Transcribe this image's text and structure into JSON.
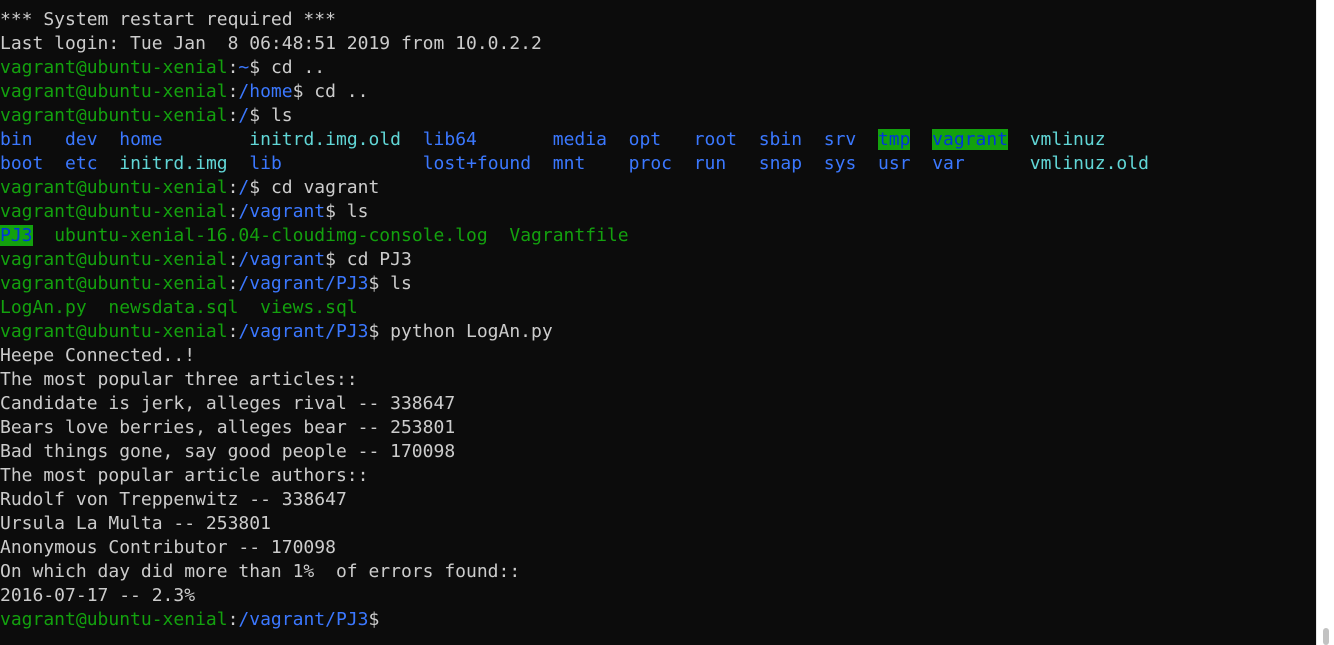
{
  "window": {
    "title": "vagrant@ubuntu-xenial: /vagrant/PJ3"
  },
  "colors": {
    "background": "#0c0c0c",
    "text": "#cccccc",
    "prompt_green": "#13a10e",
    "path_blue": "#3b78ff",
    "file_cyan": "#61d6d6",
    "highlight_bg": "#13a10e"
  },
  "terminal": {
    "lines": [
      {
        "segments": [
          {
            "text": "*** System restart required ***",
            "style": "white"
          }
        ]
      },
      {
        "segments": [
          {
            "text": "Last login: Tue Jan  8 06:48:51 2019 from 10.0.2.2",
            "style": "white"
          }
        ]
      },
      {
        "segments": [
          {
            "text": "vagrant@ubuntu-xenial",
            "style": "green"
          },
          {
            "text": ":",
            "style": "white"
          },
          {
            "text": "~",
            "style": "blue"
          },
          {
            "text": "$ cd ..",
            "style": "white"
          }
        ]
      },
      {
        "segments": [
          {
            "text": "vagrant@ubuntu-xenial",
            "style": "green"
          },
          {
            "text": ":",
            "style": "white"
          },
          {
            "text": "/home",
            "style": "blue"
          },
          {
            "text": "$ cd ..",
            "style": "white"
          }
        ]
      },
      {
        "segments": [
          {
            "text": "vagrant@ubuntu-xenial",
            "style": "green"
          },
          {
            "text": ":",
            "style": "white"
          },
          {
            "text": "/",
            "style": "blue"
          },
          {
            "text": "$ ls",
            "style": "white"
          }
        ]
      },
      {
        "segments": [
          {
            "text": "bin",
            "style": "blue"
          },
          {
            "text": "   ",
            "style": "white"
          },
          {
            "text": "dev",
            "style": "blue"
          },
          {
            "text": "  ",
            "style": "white"
          },
          {
            "text": "home",
            "style": "blue"
          },
          {
            "text": "        ",
            "style": "white"
          },
          {
            "text": "initrd.img.old",
            "style": "cyan"
          },
          {
            "text": "  ",
            "style": "white"
          },
          {
            "text": "lib64",
            "style": "blue"
          },
          {
            "text": "       ",
            "style": "white"
          },
          {
            "text": "media",
            "style": "blue"
          },
          {
            "text": "  ",
            "style": "white"
          },
          {
            "text": "opt",
            "style": "blue"
          },
          {
            "text": "   ",
            "style": "white"
          },
          {
            "text": "root",
            "style": "blue"
          },
          {
            "text": "  ",
            "style": "white"
          },
          {
            "text": "sbin",
            "style": "blue"
          },
          {
            "text": "  ",
            "style": "white"
          },
          {
            "text": "srv",
            "style": "blue"
          },
          {
            "text": "  ",
            "style": "white"
          },
          {
            "text": "tmp",
            "style": "hl"
          },
          {
            "text": "  ",
            "style": "white"
          },
          {
            "text": "vagrant",
            "style": "hl"
          },
          {
            "text": "  ",
            "style": "white"
          },
          {
            "text": "vmlinuz",
            "style": "cyan"
          }
        ]
      },
      {
        "segments": [
          {
            "text": "boot",
            "style": "blue"
          },
          {
            "text": "  ",
            "style": "white"
          },
          {
            "text": "etc",
            "style": "blue"
          },
          {
            "text": "  ",
            "style": "white"
          },
          {
            "text": "initrd.img",
            "style": "cyan"
          },
          {
            "text": "  ",
            "style": "white"
          },
          {
            "text": "lib",
            "style": "blue"
          },
          {
            "text": "             ",
            "style": "white"
          },
          {
            "text": "lost+found",
            "style": "blue"
          },
          {
            "text": "  ",
            "style": "white"
          },
          {
            "text": "mnt",
            "style": "blue"
          },
          {
            "text": "    ",
            "style": "white"
          },
          {
            "text": "proc",
            "style": "blue"
          },
          {
            "text": "  ",
            "style": "white"
          },
          {
            "text": "run",
            "style": "blue"
          },
          {
            "text": "   ",
            "style": "white"
          },
          {
            "text": "snap",
            "style": "blue"
          },
          {
            "text": "  ",
            "style": "white"
          },
          {
            "text": "sys",
            "style": "blue"
          },
          {
            "text": "  ",
            "style": "white"
          },
          {
            "text": "usr",
            "style": "blue"
          },
          {
            "text": "  ",
            "style": "white"
          },
          {
            "text": "var",
            "style": "blue"
          },
          {
            "text": "      ",
            "style": "white"
          },
          {
            "text": "vmlinuz.old",
            "style": "cyan"
          }
        ]
      },
      {
        "segments": [
          {
            "text": "vagrant@ubuntu-xenial",
            "style": "green"
          },
          {
            "text": ":",
            "style": "white"
          },
          {
            "text": "/",
            "style": "blue"
          },
          {
            "text": "$ cd vagrant",
            "style": "white"
          }
        ]
      },
      {
        "segments": [
          {
            "text": "vagrant@ubuntu-xenial",
            "style": "green"
          },
          {
            "text": ":",
            "style": "white"
          },
          {
            "text": "/vagrant",
            "style": "blue"
          },
          {
            "text": "$ ls",
            "style": "white"
          }
        ]
      },
      {
        "segments": [
          {
            "text": "PJ3",
            "style": "hl"
          },
          {
            "text": "  ",
            "style": "white"
          },
          {
            "text": "ubuntu-xenial-16.04-cloudimg-console.log",
            "style": "green"
          },
          {
            "text": "  ",
            "style": "white"
          },
          {
            "text": "Vagrantfile",
            "style": "green"
          }
        ]
      },
      {
        "segments": [
          {
            "text": "vagrant@ubuntu-xenial",
            "style": "green"
          },
          {
            "text": ":",
            "style": "white"
          },
          {
            "text": "/vagrant",
            "style": "blue"
          },
          {
            "text": "$ cd PJ3",
            "style": "white"
          }
        ]
      },
      {
        "segments": [
          {
            "text": "vagrant@ubuntu-xenial",
            "style": "green"
          },
          {
            "text": ":",
            "style": "white"
          },
          {
            "text": "/vagrant/PJ3",
            "style": "blue"
          },
          {
            "text": "$ ls",
            "style": "white"
          }
        ]
      },
      {
        "segments": [
          {
            "text": "LogAn.py",
            "style": "green"
          },
          {
            "text": "  ",
            "style": "white"
          },
          {
            "text": "newsdata.sql",
            "style": "green"
          },
          {
            "text": "  ",
            "style": "white"
          },
          {
            "text": "views.sql",
            "style": "green"
          }
        ]
      },
      {
        "segments": [
          {
            "text": "vagrant@ubuntu-xenial",
            "style": "green"
          },
          {
            "text": ":",
            "style": "white"
          },
          {
            "text": "/vagrant/PJ3",
            "style": "blue"
          },
          {
            "text": "$ python LogAn.py",
            "style": "white"
          }
        ]
      },
      {
        "segments": [
          {
            "text": "Heepe Connected..!",
            "style": "white"
          }
        ]
      },
      {
        "segments": [
          {
            "text": "The most popular three articles::",
            "style": "white"
          }
        ]
      },
      {
        "segments": [
          {
            "text": "Candidate is jerk, alleges rival -- 338647",
            "style": "white"
          }
        ]
      },
      {
        "segments": [
          {
            "text": "Bears love berries, alleges bear -- 253801",
            "style": "white"
          }
        ]
      },
      {
        "segments": [
          {
            "text": "Bad things gone, say good people -- 170098",
            "style": "white"
          }
        ]
      },
      {
        "segments": [
          {
            "text": "The most popular article authors::",
            "style": "white"
          }
        ]
      },
      {
        "segments": [
          {
            "text": "Rudolf von Treppenwitz -- 338647",
            "style": "white"
          }
        ]
      },
      {
        "segments": [
          {
            "text": "Ursula La Multa -- 253801",
            "style": "white"
          }
        ]
      },
      {
        "segments": [
          {
            "text": "Anonymous Contributor -- 170098",
            "style": "white"
          }
        ]
      },
      {
        "segments": [
          {
            "text": "On which day did more than 1%  of errors found::",
            "style": "white"
          }
        ]
      },
      {
        "segments": [
          {
            "text": "2016-07-17 -- 2.3%",
            "style": "white"
          }
        ]
      },
      {
        "segments": [
          {
            "text": "vagrant@ubuntu-xenial",
            "style": "green"
          },
          {
            "text": ":",
            "style": "white"
          },
          {
            "text": "/vagrant/PJ3",
            "style": "blue"
          },
          {
            "text": "$",
            "style": "white"
          }
        ]
      }
    ]
  }
}
